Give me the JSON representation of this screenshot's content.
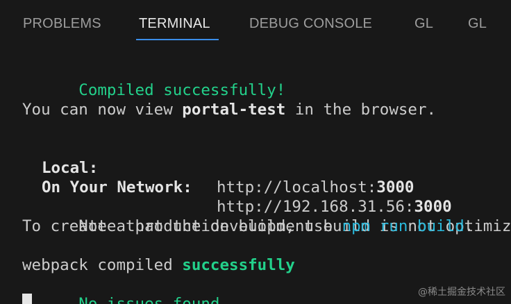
{
  "tabs": [
    {
      "label": "PROBLEMS",
      "active": false
    },
    {
      "label": "TERMINAL",
      "active": true
    },
    {
      "label": "DEBUG CONSOLE",
      "active": false
    },
    {
      "label": "GL",
      "active": false
    },
    {
      "label": "GL",
      "active": false
    }
  ],
  "terminal": {
    "compiled": "Compiled successfully!",
    "view_prefix": "You can now view ",
    "app_name": "portal-test",
    "view_suffix": " in the browser.",
    "local_label": "Local:",
    "local_url_base": "http://localhost:",
    "local_port": "3000",
    "network_label": "On Your Network:",
    "network_url_base": "http://192.168.31.56:",
    "network_port": "3000",
    "note_line1": "Note that the development build is not optimized.",
    "note_line2_prefix": "To create a production build, use ",
    "note_command": "npm run build",
    "note_line2_suffix": ".",
    "webpack_prefix": "webpack compiled ",
    "webpack_status": "successfully",
    "no_issues": "No issues found."
  },
  "watermark": "@稀土掘金技术社区",
  "colors": {
    "background": "#181818",
    "tab_active_underline": "#3b8eea",
    "success_green": "#23d18b",
    "command_cyan": "#29b8db",
    "text": "#cccccc"
  }
}
